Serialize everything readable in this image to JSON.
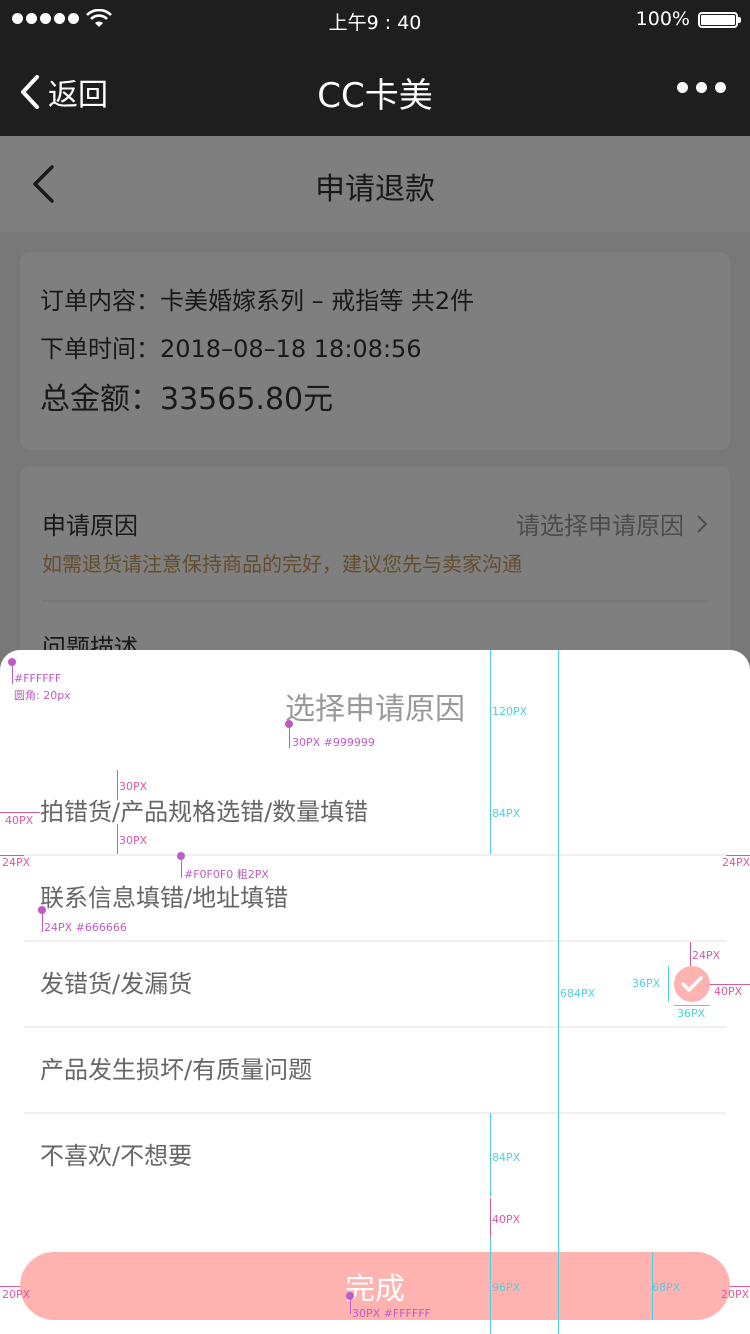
{
  "status_bar": {
    "time": "上午9 : 40",
    "battery": "100%"
  },
  "wechat_bar": {
    "back_label": "返回",
    "title": "CC卡美"
  },
  "page": {
    "title": "申请退款"
  },
  "order": {
    "content_label": "订单内容：",
    "content_value": "卡美婚嫁系列 – 戒指等 共2件",
    "time_label": "下单时间：",
    "time_value": "2018–08–18 18:08:56",
    "total_label": "总金额：",
    "total_value": "33565.80元"
  },
  "refund_form": {
    "reason_label": "申请原因",
    "reason_placeholder": "请选择申请原因",
    "reason_hint": "如需退货请注意保持商品的完好，建议您先与卖家沟通",
    "description_label": "问题描述"
  },
  "sheet": {
    "title": "选择申请原因",
    "options": [
      {
        "label": "拍错货/产品规格选错/数量填错",
        "selected": false
      },
      {
        "label": "联系信息填错/地址填错",
        "selected": false
      },
      {
        "label": "发错货/发漏货",
        "selected": true
      },
      {
        "label": "产品发生损坏/有质量问题",
        "selected": false
      },
      {
        "label": "不喜欢/不想要",
        "selected": false
      }
    ],
    "done_label": "完成"
  },
  "colors": {
    "accent": "#FFB3B0",
    "overlay": "rgba(0,0,0,0.5)",
    "divider": "#F0F0F0",
    "option_text": "#666666",
    "title_text": "#999999"
  },
  "annotations": {
    "sheet_bg": "#FFFFFF",
    "sheet_radius": "圆角: 20px",
    "title_spec": "30PX #999999",
    "divider_spec": "#F0F0F0 粗2PX",
    "option_spec": "24PX #666666",
    "button_spec": "30PX #FFFFFF",
    "m30a": "30PX",
    "m30b": "30PX",
    "m40": "40PX",
    "m24l": "24PX",
    "m24r": "24PX",
    "c120": "120PX",
    "c84a": "84PX",
    "c684": "684PX",
    "c84b": "84PX",
    "m40b": "40PX",
    "c96": "96PX",
    "c68": "68PX",
    "m20l": "20PX",
    "m20r": "20PX",
    "check_top": "24PX",
    "check_h": "36PX",
    "check_w": "36PX",
    "check_right": "40PX"
  }
}
